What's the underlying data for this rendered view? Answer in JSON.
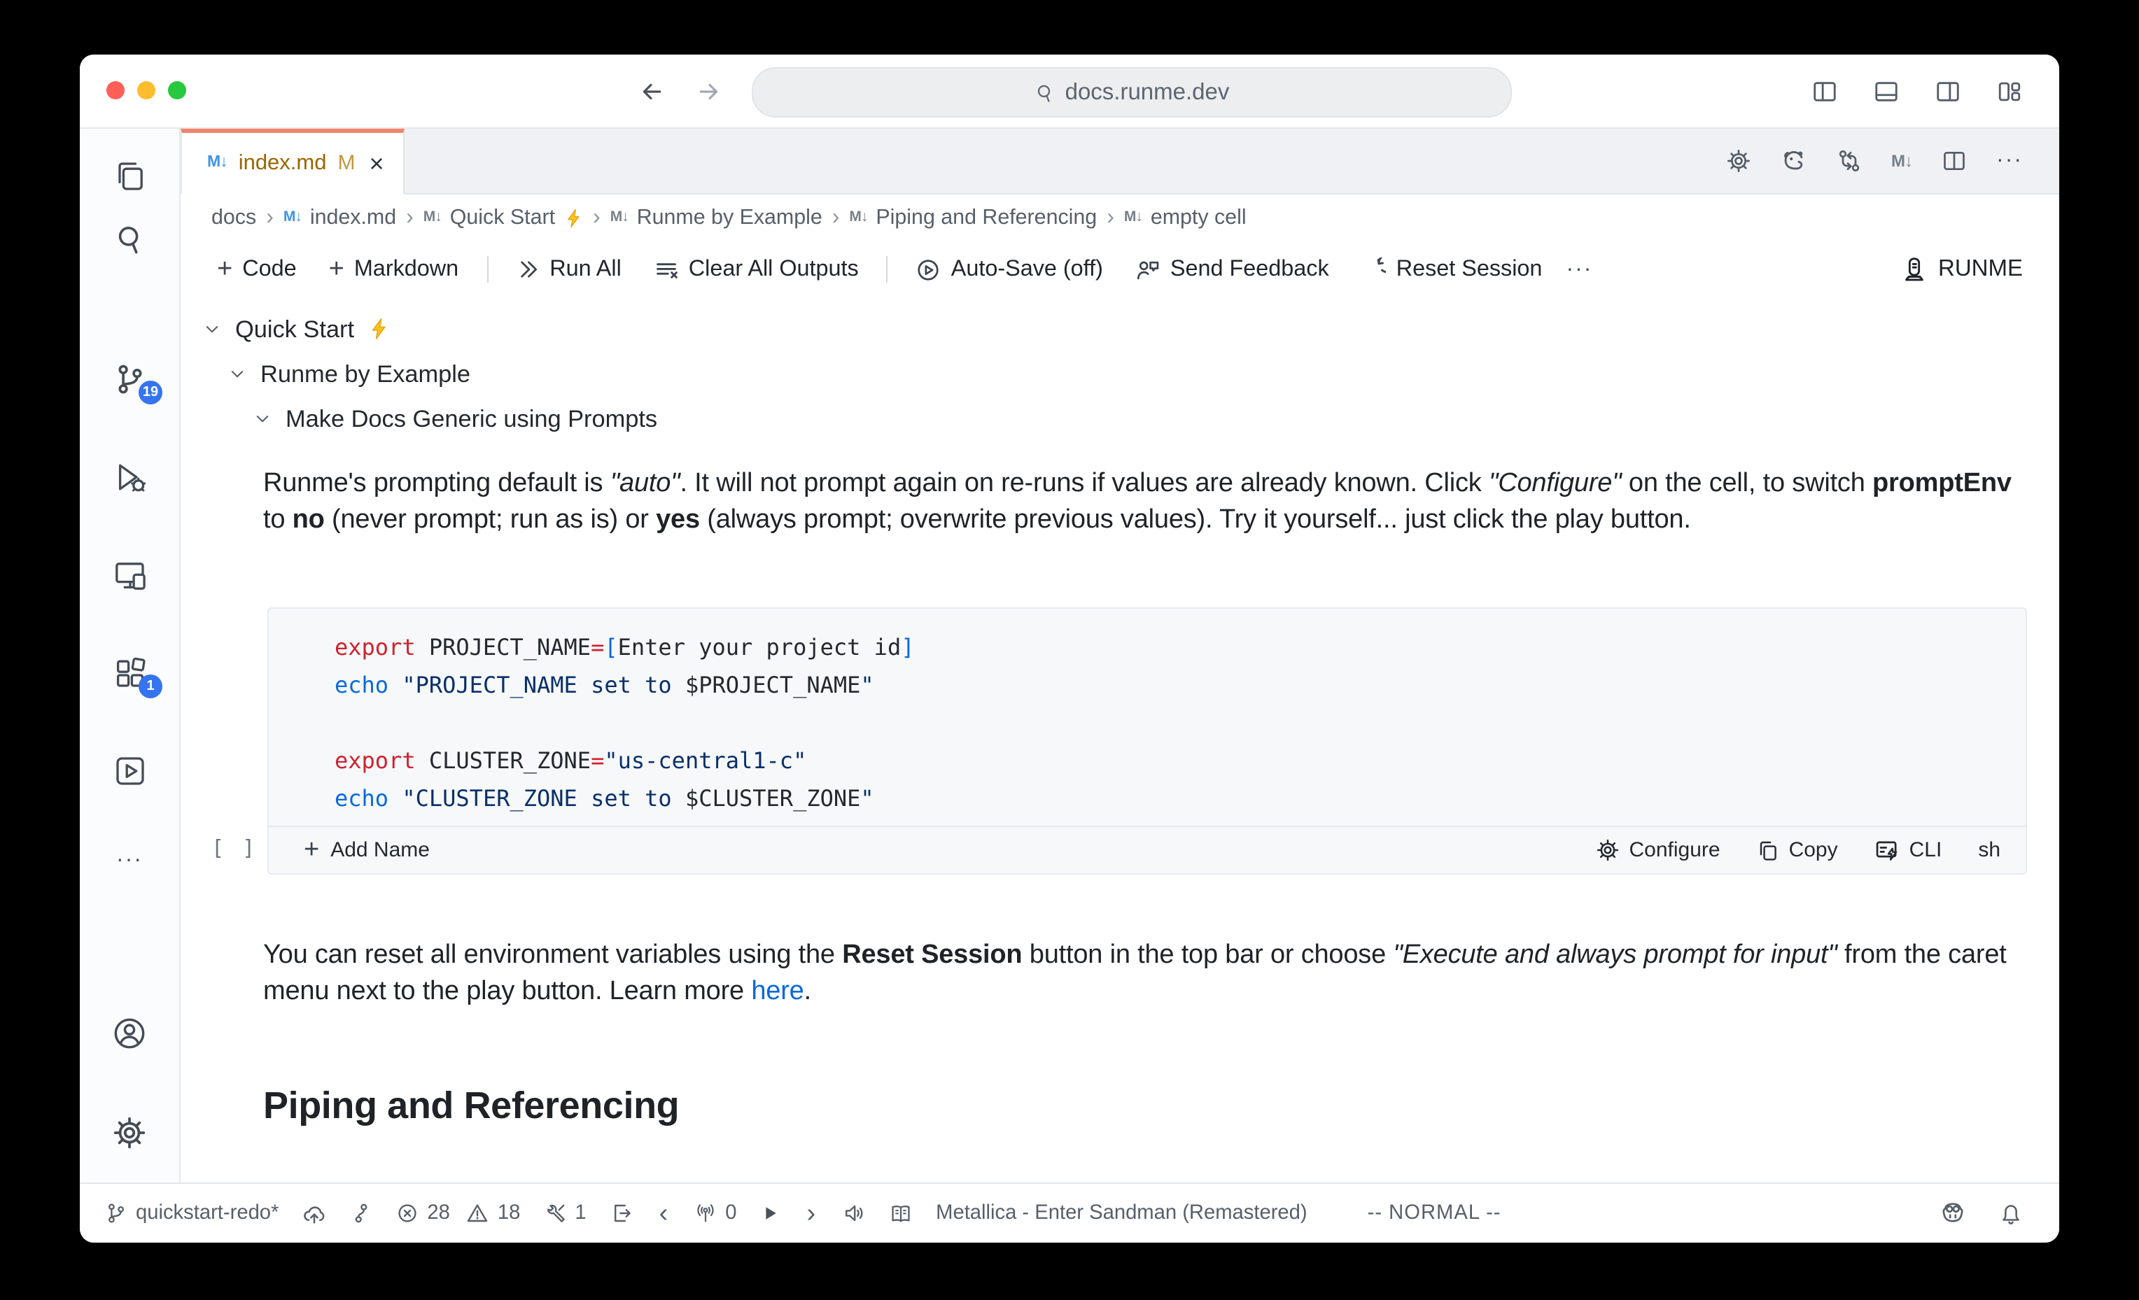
{
  "chrome": {
    "url": "docs.runme.dev"
  },
  "tab": {
    "title": "index.md",
    "badge": "M",
    "close": "×",
    "md_glyph": "M↓"
  },
  "breadcrumb": {
    "separator": "›",
    "items": [
      {
        "label": "docs"
      },
      {
        "label": "index.md"
      },
      {
        "label": "Quick Start"
      },
      {
        "label": "Runme by Example"
      },
      {
        "label": "Piping and Referencing"
      },
      {
        "label": "empty cell"
      }
    ]
  },
  "toolbar": {
    "plus": "+",
    "code": "Code",
    "markdown": "Markdown",
    "run_all": "Run All",
    "clear_all": "Clear All Outputs",
    "auto_save": "Auto-Save (off)",
    "send_feedback": "Send Feedback",
    "reset_session": "Reset Session",
    "more": "···",
    "runme": "RUNME"
  },
  "outline": {
    "items": [
      {
        "label": "Quick Start"
      },
      {
        "label": "Runme by Example"
      },
      {
        "label": "Make Docs Generic using Prompts"
      }
    ]
  },
  "content": {
    "paragraph1": [
      {
        "t": "Runme's prompting default is "
      },
      {
        "t": "\"auto\"",
        "i": true
      },
      {
        "t": ". It will not prompt again on re-runs if values are already known. Click "
      },
      {
        "t": "\"Configure\"",
        "i": true
      },
      {
        "t": " on the cell, to switch "
      },
      {
        "t": "promptEnv",
        "b": true
      },
      {
        "t": " to "
      },
      {
        "t": "no",
        "b": true
      },
      {
        "t": " (never prompt; run as is) or "
      },
      {
        "t": "yes",
        "b": true
      },
      {
        "t": " (always prompt; overwrite previous values). Try it yourself... just click the play button."
      }
    ],
    "code_lines": [
      [
        {
          "t": "export",
          "c": "red"
        },
        {
          "t": " PROJECT_NAME",
          "c": "ink"
        },
        {
          "t": "=",
          "c": "red"
        },
        {
          "t": "[",
          "c": "blue"
        },
        {
          "t": "Enter your project id",
          "c": "ink"
        },
        {
          "t": "]",
          "c": "blue"
        }
      ],
      [
        {
          "t": "echo",
          "c": "blue"
        },
        {
          "t": " ",
          "c": "ink"
        },
        {
          "t": "\"PROJECT_NAME set to ",
          "c": "navy"
        },
        {
          "t": "$PROJECT_NAME",
          "c": "ink"
        },
        {
          "t": "\"",
          "c": "navy"
        }
      ],
      [],
      [
        {
          "t": "export",
          "c": "red"
        },
        {
          "t": " CLUSTER_ZONE",
          "c": "ink"
        },
        {
          "t": "=",
          "c": "red"
        },
        {
          "t": "\"us-central1-c\"",
          "c": "navy"
        }
      ],
      [
        {
          "t": "echo",
          "c": "blue"
        },
        {
          "t": " ",
          "c": "ink"
        },
        {
          "t": "\"CLUSTER_ZONE set to ",
          "c": "navy"
        },
        {
          "t": "$CLUSTER_ZONE",
          "c": "ink"
        },
        {
          "t": "\"",
          "c": "navy"
        }
      ]
    ],
    "cell": {
      "gutter": "[ ]",
      "add_name": "Add Name",
      "configure": "Configure",
      "copy": "Copy",
      "cli": "CLI",
      "lang": "sh"
    },
    "paragraph2": [
      {
        "t": "You can reset all environment variables using the "
      },
      {
        "t": "Reset Session",
        "b": true
      },
      {
        "t": " button in the top bar or choose "
      },
      {
        "t": "\"Execute and always prompt for input\"",
        "i": true
      },
      {
        "t": " from the caret menu next to the play button. Learn more "
      },
      {
        "t": "here",
        "c": "link"
      },
      {
        "t": "."
      }
    ],
    "heading": "Piping and Referencing"
  },
  "statusbar": {
    "branch": "quickstart-redo*",
    "errors": "28",
    "warnings": "18",
    "tools_count": "1",
    "broadcast_count": "0",
    "song": "Metallica - Enter Sandman (Remastered)",
    "mode": "-- NORMAL --"
  },
  "activitybar": {
    "scm_badge": "19",
    "ext_badge": "1",
    "more": "···"
  },
  "colors": {
    "tab_accent": "#F2846B",
    "badge_blue": "#3574F0",
    "link_blue": "#0969DA",
    "modified_gold": "#9A6700",
    "keyword_red": "#CF222E",
    "string_navy": "#0A3069",
    "punct_blue": "#0969DA",
    "bolt_gold": "#FFC31F"
  }
}
